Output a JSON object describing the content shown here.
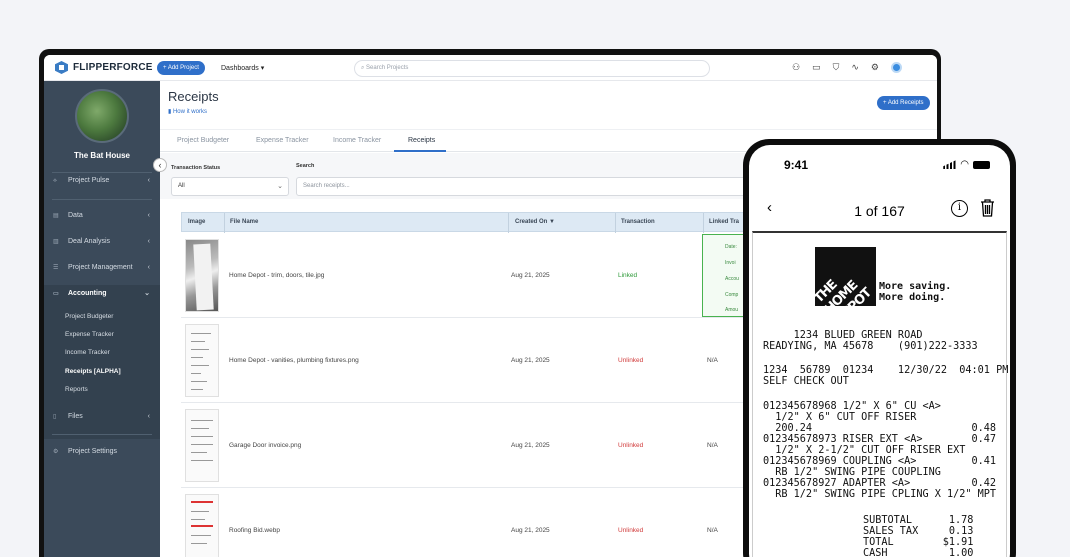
{
  "topbar": {
    "brand": "FLIPPERFORCE",
    "add_project": "+ Add Project",
    "dashboards": "Dashboards ▾",
    "search_placeholder": "Search Projects"
  },
  "sidebar": {
    "property_name": "The Bat House",
    "items": [
      {
        "label": "Project Pulse"
      },
      {
        "label": "Data"
      },
      {
        "label": "Deal Analysis"
      },
      {
        "label": "Project Management"
      },
      {
        "label": "Accounting"
      },
      {
        "label": "Files"
      },
      {
        "label": "Project Settings"
      }
    ],
    "accounting_sub": [
      "Project Budgeter",
      "Expense Tracker",
      "Income Tracker",
      "Receipts [ALPHA]",
      "Reports"
    ]
  },
  "main": {
    "title": "Receipts",
    "how_it_works": "How it works",
    "add_receipts": "+ Add Receipts",
    "tabs": [
      "Project Budgeter",
      "Expense Tracker",
      "Income Tracker",
      "Receipts"
    ],
    "filter_status_label": "Transaction Status",
    "filter_status_value": "All",
    "search_label": "Search",
    "search_placeholder": "Search receipts...",
    "columns": [
      "Image",
      "File Name",
      "Created On ▼",
      "Transaction",
      "Linked Tra"
    ],
    "rows": [
      {
        "file": "Home Depot - trim, doors, tile.jpg",
        "date": "Aug 21, 2025",
        "tx": "Linked",
        "lt": ""
      },
      {
        "file": "Home Depot - vanities, plumbing fixtures.png",
        "date": "Aug 21, 2025",
        "tx": "Unlinked",
        "lt": "N/A"
      },
      {
        "file": "Garage Door invoice.png",
        "date": "Aug 21, 2025",
        "tx": "Unlinked",
        "lt": "N/A"
      },
      {
        "file": "Roofing Bid.webp",
        "date": "Aug 21, 2025",
        "tx": "Unlinked",
        "lt": "N/A"
      }
    ],
    "linked_box": [
      "Date:",
      "Invoi",
      "Accou",
      "Comp",
      "Amou"
    ]
  },
  "phone": {
    "time": "9:41",
    "counter": "1 of 167",
    "receipt": {
      "logo_text": "THE HOME DEPOT",
      "tagline_1": "More saving.",
      "tagline_2": "More doing.",
      "address": "     1234 BLUED GREEN ROAD\nREADYING, MA 45678    (901)222-3333",
      "store_line": "1234  56789  01234    12/30/22  04:01 PM\nSELF CHECK OUT",
      "items": "012345678968 1/2\" X 6\" CU <A>\n  1/2\" X 6\" CUT OFF RISER\n  200.24                          0.48\n012345678973 RISER EXT <A>        0.47\n  1/2\" X 2-1/2\" CUT OFF RISER EXT\n012345678969 COUPLING <A>         0.41\n  RB 1/2\" SWING PIPE COUPLING\n012345678927 ADAPTER <A>          0.42\n  RB 1/2\" SWING PIPE CPLING X 1/2\" MPT",
      "totals": "SUBTOTAL      1.78\nSALES TAX     0.13\nTOTAL        $1.91\nCASH          1.00"
    }
  }
}
